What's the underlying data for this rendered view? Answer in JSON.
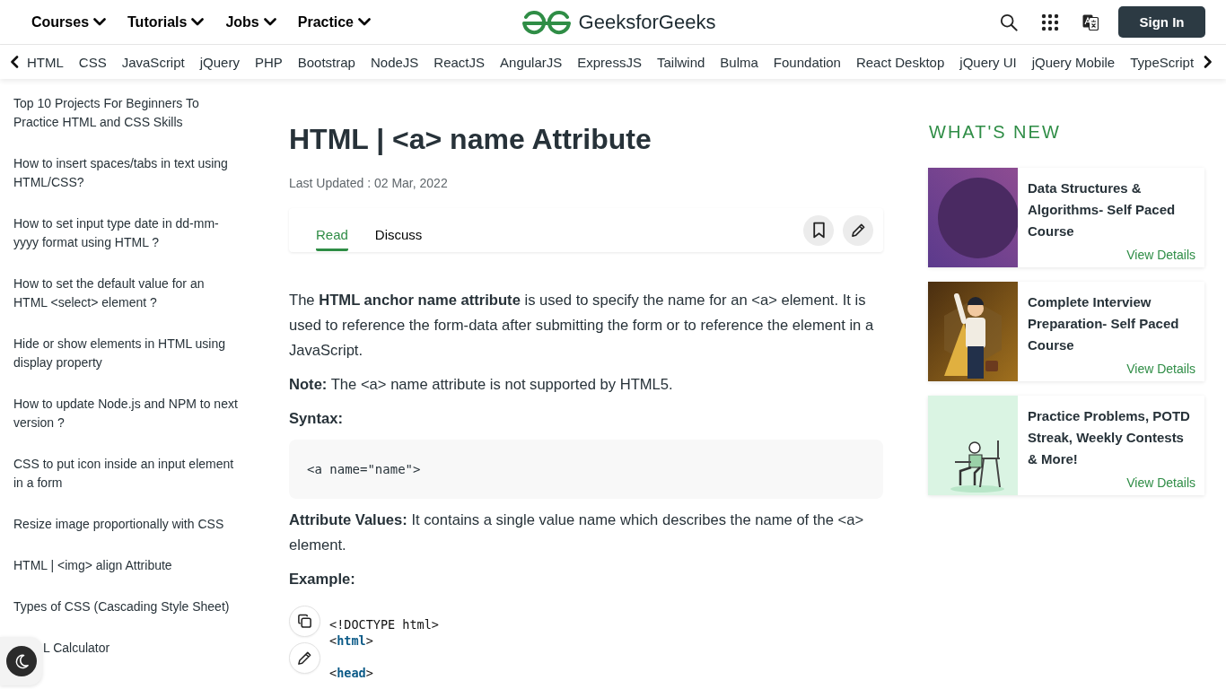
{
  "header": {
    "menus": [
      {
        "label": "Courses"
      },
      {
        "label": "Tutorials"
      },
      {
        "label": "Jobs"
      },
      {
        "label": "Practice"
      }
    ],
    "logo_text": "GeeksforGeeks",
    "sign_in_button": "Sign In"
  },
  "topic_bar": {
    "items": [
      "HTML",
      "CSS",
      "JavaScript",
      "jQuery",
      "PHP",
      "Bootstrap",
      "NodeJS",
      "ReactJS",
      "AngularJS",
      "ExpressJS",
      "Tailwind",
      "Bulma",
      "Foundation",
      "React Desktop",
      "jQuery UI",
      "jQuery Mobile",
      "TypeScript"
    ]
  },
  "sidebar": {
    "items": [
      {
        "text": "Top 10 Projects For Beginners To Practice HTML and CSS Skills",
        "covered": false
      },
      {
        "text": "How to insert spaces/tabs in text using HTML/CSS?",
        "covered": false
      },
      {
        "text": "How to set input type date in dd-mm-yyyy format using HTML ?",
        "covered": false
      },
      {
        "text": "How to set the default value for an HTML <select> element ?",
        "covered": false
      },
      {
        "text": "Hide or show elements in HTML using display property",
        "covered": false
      },
      {
        "text": "How to update Node.js and NPM to next version ?",
        "covered": false
      },
      {
        "text": "CSS to put icon inside an input element in a form",
        "covered": false
      },
      {
        "text": "Resize image proportionally with CSS",
        "covered": false
      },
      {
        "text": "HTML | <img> align Attribute",
        "covered": false
      },
      {
        "text": "Types of CSS (Cascading Style Sheet)",
        "covered": false
      },
      {
        "text": "L Calculator",
        "covered": true
      }
    ]
  },
  "article": {
    "title": "HTML | <a> name Attribute",
    "last_updated": "Last Updated : 02 Mar, 2022",
    "tabs": [
      {
        "label": "Read",
        "selected": true
      },
      {
        "label": "Discuss",
        "selected": false
      }
    ],
    "blocks": [
      {
        "kind": "paragraph",
        "text": "The **HTML anchor name attribute** is used to specify the name for an <a> element. It is used to reference the form-data after submitting the form or to reference the element in a JavaScript."
      },
      {
        "kind": "paragraph",
        "text": "**Note:** The <a> name attribute is not supported by HTML5."
      },
      {
        "kind": "heading",
        "text": "Syntax:"
      },
      {
        "kind": "code",
        "text": "<a name=\"name\">"
      },
      {
        "kind": "paragraph",
        "text": "**Attribute Values:** It contains a single value name which describes the name of the <a> element."
      },
      {
        "kind": "heading",
        "text": "Example:"
      },
      {
        "kind": "example",
        "code": "<!DOCTYPE html>\n<**html**>\n\n<**head**>"
      }
    ]
  },
  "whats_new": {
    "heading": "WHAT'S NEW",
    "cards": [
      {
        "kind": "circle",
        "title": "Data Structures & Algorithms- Self Paced Course",
        "link": "View Details"
      },
      {
        "kind": "hero",
        "title": "Complete Interview Preparation- Self Paced Course",
        "link": "View Details"
      },
      {
        "kind": "study",
        "title": "Practice Problems, POTD Streak, Weekly Contests & More!",
        "link": "View Details"
      }
    ]
  }
}
